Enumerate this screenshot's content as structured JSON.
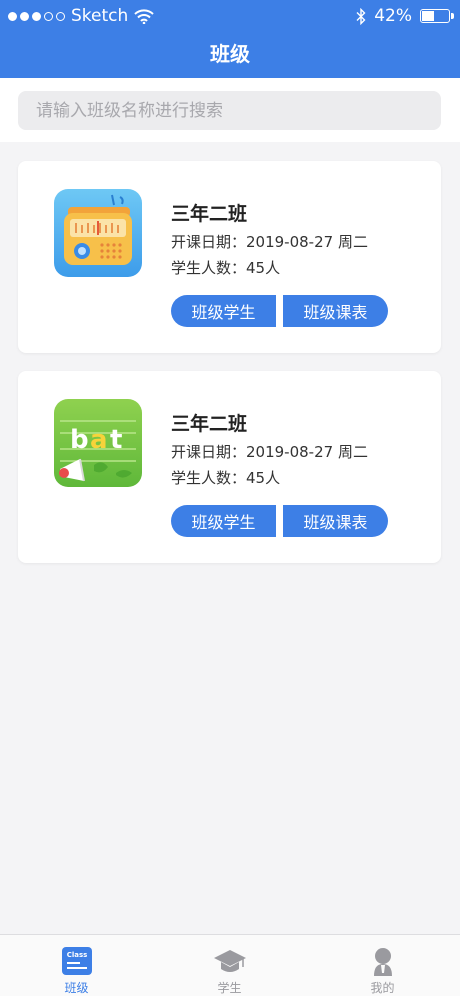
{
  "status_bar": {
    "carrier": "Sketch",
    "battery": "42%",
    "battery_level": 0.42
  },
  "header": {
    "title": "班级"
  },
  "search": {
    "placeholder": "请输入班级名称进行搜索"
  },
  "classes": [
    {
      "name": "三年二班",
      "start_date": "开课日期：2019-08-27 周二",
      "student_count": "学生人数：45人",
      "btn_students": "班级学生",
      "btn_schedule": "班级课表",
      "image_icon": "radio-app-icon"
    },
    {
      "name": "三年二班",
      "start_date": "开课日期：2019-08-27 周二",
      "student_count": "学生人数：45人",
      "btn_students": "班级学生",
      "btn_schedule": "班级课表",
      "image_icon": "bat-word-megaphone-icon"
    }
  ],
  "tabbar": {
    "items": [
      {
        "label": "班级",
        "icon": "class-icon",
        "icon_text": "Class",
        "active": true
      },
      {
        "label": "学生",
        "icon": "graduation-cap-icon",
        "active": false
      },
      {
        "label": "我的",
        "icon": "person-icon",
        "active": false
      }
    ]
  },
  "colors": {
    "primary": "#3d7fe6",
    "background": "#f4f4f6",
    "inactive_tab": "#9a9a9f"
  }
}
